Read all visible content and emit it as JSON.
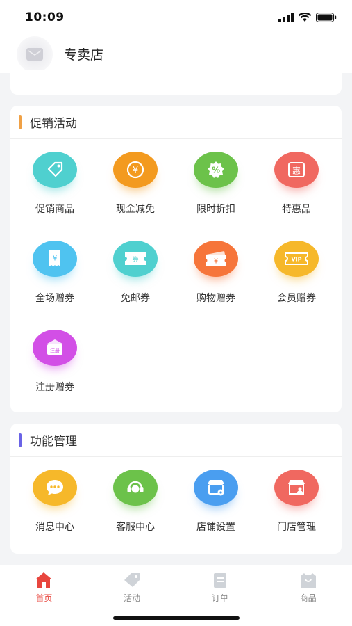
{
  "status_bar": {
    "time": "10:09"
  },
  "header": {
    "store_name": "专卖店"
  },
  "promo": {
    "title": "促销活动",
    "accent": "#f0a146",
    "items": [
      {
        "label": "促销商品",
        "icon": "tag-icon",
        "color": "#4fd0cf",
        "glyph": ""
      },
      {
        "label": "现金减免",
        "icon": "coin-icon",
        "color": "#f39a1f",
        "glyph": "¥"
      },
      {
        "label": "限时折扣",
        "icon": "percent-icon",
        "color": "#6cc24a",
        "glyph": "%"
      },
      {
        "label": "特惠品",
        "icon": "discount-badge-icon",
        "color": "#f06860",
        "glyph": "惠"
      },
      {
        "label": "全场赠券",
        "icon": "receipt-icon",
        "color": "#4fc3f0",
        "glyph": "¥"
      },
      {
        "label": "免邮券",
        "icon": "ticket-icon",
        "color": "#4fd0cf",
        "glyph": "券"
      },
      {
        "label": "购物赠券",
        "icon": "shopping-ticket-icon",
        "color": "#f6753a",
        "glyph": "¥"
      },
      {
        "label": "会员赠券",
        "icon": "vip-ticket-icon",
        "color": "#f6b82a",
        "glyph": "VIP"
      },
      {
        "label": "注册赠券",
        "icon": "register-coupon-icon",
        "color": "#d24fe6",
        "glyph": "注册"
      }
    ]
  },
  "functions": {
    "title": "功能管理",
    "accent": "#6a63e6",
    "items": [
      {
        "label": "消息中心",
        "icon": "message-icon",
        "color": "#f6b82a"
      },
      {
        "label": "客服中心",
        "icon": "customer-service-icon",
        "color": "#6cc24a"
      },
      {
        "label": "店铺设置",
        "icon": "shop-settings-icon",
        "color": "#4a9ef0"
      },
      {
        "label": "门店管理",
        "icon": "store-icon",
        "color": "#f06860"
      }
    ]
  },
  "tabbar": {
    "items": [
      {
        "label": "首页",
        "icon": "home-icon",
        "active": true
      },
      {
        "label": "活动",
        "icon": "activity-tag-icon",
        "active": false
      },
      {
        "label": "订单",
        "icon": "order-icon",
        "active": false
      },
      {
        "label": "商品",
        "icon": "product-bag-icon",
        "active": false
      }
    ]
  }
}
